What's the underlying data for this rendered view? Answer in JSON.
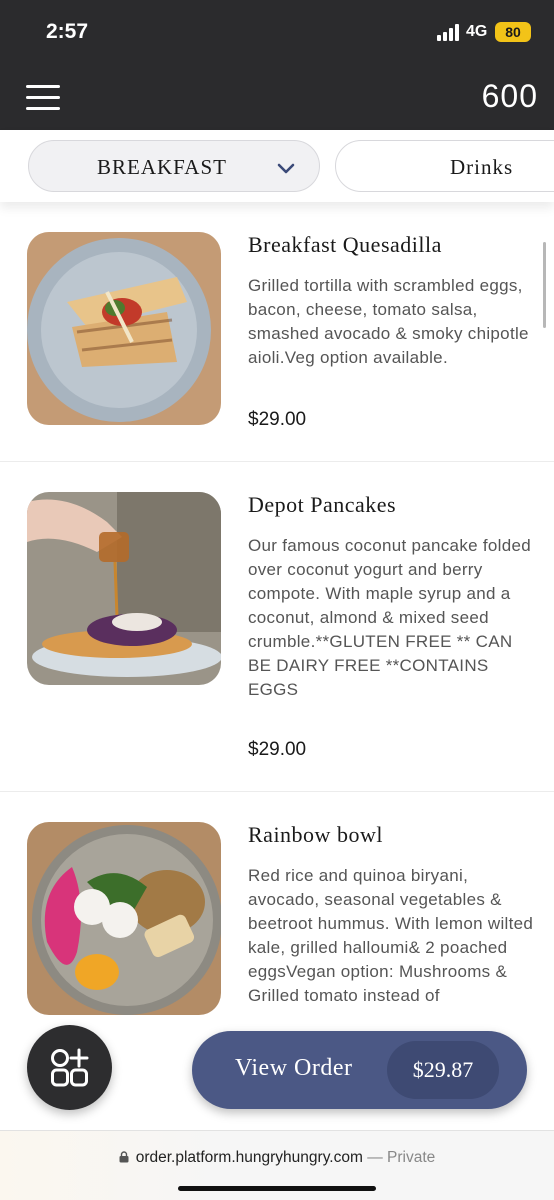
{
  "status_bar": {
    "time": "2:57",
    "network": "4G",
    "battery": "80"
  },
  "header": {
    "count": "600"
  },
  "categories": {
    "selected": "BREAKFAST",
    "next": "Drinks"
  },
  "items": [
    {
      "name": "Breakfast Quesadilla",
      "description": "Grilled tortilla with scrambled eggs, bacon, cheese, tomato salsa, smashed avocado & smoky chipotle aioli.Veg option available.",
      "price": "$29.00"
    },
    {
      "name": "Depot Pancakes",
      "description": "Our famous coconut pancake folded over coconut yogurt and berry compote. With maple syrup and a coconut, almond & mixed seed crumble.**GLUTEN FREE ** CAN BE DAIRY FREE **CONTAINS EGGS",
      "price": "$29.00"
    },
    {
      "name": "Rainbow bowl",
      "description": "Red rice and quinoa biryani, avocado, seasonal vegetables & beetroot hummus. With lemon wilted kale, grilled halloumi& 2 poached eggsVegan option: Mushrooms & Grilled tomato instead of"
    }
  ],
  "order": {
    "label": "View Order",
    "total": "$29.87"
  },
  "browser": {
    "url": "order.platform.hungryhungry.com",
    "separator": " — ",
    "mode": "Private"
  },
  "icons": {
    "menu": "hamburger-icon",
    "chevron": "chevron-down-icon",
    "fab": "grid-plus-icon",
    "lock": "lock-icon"
  },
  "colors": {
    "header_bg": "#2b2b2d",
    "order_button": "#4b5885",
    "battery": "#f2c318"
  }
}
